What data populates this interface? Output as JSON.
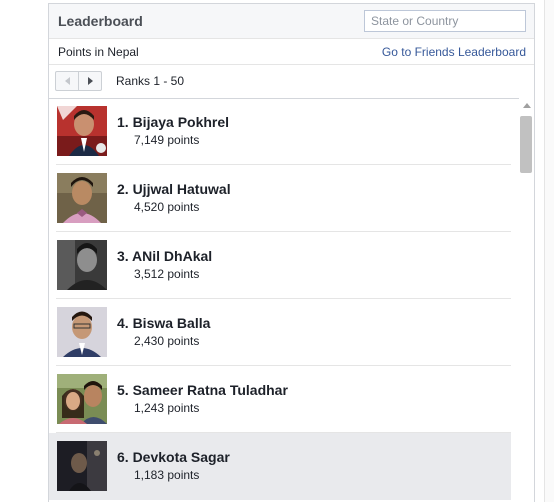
{
  "header": {
    "title": "Leaderboard",
    "search_placeholder": "State or Country"
  },
  "subheader": {
    "left": "Points in Nepal",
    "link": "Go to Friends Leaderboard"
  },
  "pager": {
    "label": "Ranks 1 - 50"
  },
  "entries": [
    {
      "rank_name": "1. Bijaya Pokhrel",
      "points": "7,149 points"
    },
    {
      "rank_name": "2. Ujjwal Hatuwal",
      "points": "4,520 points"
    },
    {
      "rank_name": "3. ANil DhAkal",
      "points": "3,512 points"
    },
    {
      "rank_name": "4. Biswa Balla",
      "points": "2,430 points"
    },
    {
      "rank_name": "5. Sameer Ratna Tuladhar",
      "points": "1,243 points"
    },
    {
      "rank_name": "6. Devkota Sagar",
      "points": "1,183 points"
    }
  ],
  "colors": {
    "link": "#365899",
    "highlight_row": "#e9eaed",
    "header_bg": "#f6f7f9"
  },
  "icons": {
    "prev": "chevron-left-icon",
    "next": "chevron-right-icon",
    "scroll_up": "arrow-up-icon"
  }
}
